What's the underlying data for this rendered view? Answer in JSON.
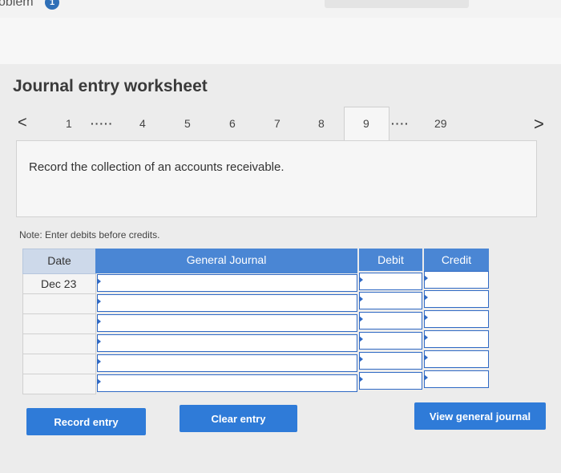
{
  "topbar": {
    "problem_label": "oblem",
    "badge": "1"
  },
  "worksheet": {
    "title": "Journal entry worksheet",
    "pager": {
      "prev": "<",
      "next": ">",
      "items": [
        "1",
        "·····",
        "4",
        "5",
        "6",
        "7",
        "8",
        "9",
        "····",
        "29"
      ],
      "active": "9"
    },
    "instruction": "Record the collection of an accounts receivable.",
    "note": "Note: Enter debits before credits."
  },
  "journal": {
    "headers": {
      "date": "Date",
      "general_journal": "General Journal",
      "debit": "Debit",
      "credit": "Credit"
    },
    "rows": [
      {
        "date": "Dec 23",
        "account": "",
        "debit": "",
        "credit": ""
      },
      {
        "date": "",
        "account": "",
        "debit": "",
        "credit": ""
      },
      {
        "date": "",
        "account": "",
        "debit": "",
        "credit": ""
      },
      {
        "date": "",
        "account": "",
        "debit": "",
        "credit": ""
      },
      {
        "date": "",
        "account": "",
        "debit": "",
        "credit": ""
      },
      {
        "date": "",
        "account": "",
        "debit": "",
        "credit": ""
      }
    ]
  },
  "buttons": {
    "record": "Record entry",
    "clear": "Clear entry",
    "view": "View general journal"
  },
  "colors": {
    "accent": "#2f7bd8",
    "header_blue": "#4a86d4",
    "cell_border": "#2f69c4"
  }
}
